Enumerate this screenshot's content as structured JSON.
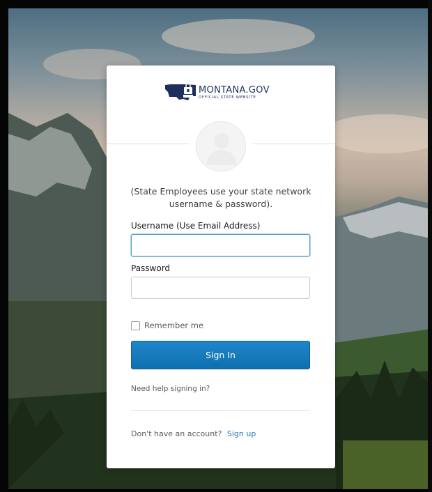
{
  "logo": {
    "mark_text": [
      "login",
      "mt",
      "gov"
    ],
    "title": "MONTANA.GOV",
    "subtitle": "OFFICIAL STATE WEBSITE"
  },
  "intro_text": "(State Employees use your state network username & password).",
  "username": {
    "label": "Username (Use Email Address)",
    "value": ""
  },
  "password": {
    "label": "Password",
    "value": ""
  },
  "remember_me": {
    "label": "Remember me",
    "checked": false
  },
  "sign_in_button": "Sign In",
  "help_link": "Need help signing in?",
  "signup": {
    "prompt": "Don't have an account?",
    "link": "Sign up"
  },
  "colors": {
    "primary_button": "#1578bd",
    "link": "#1e74b8",
    "focus_border": "#5a9fc8",
    "logo_navy": "#1d2f5c"
  }
}
